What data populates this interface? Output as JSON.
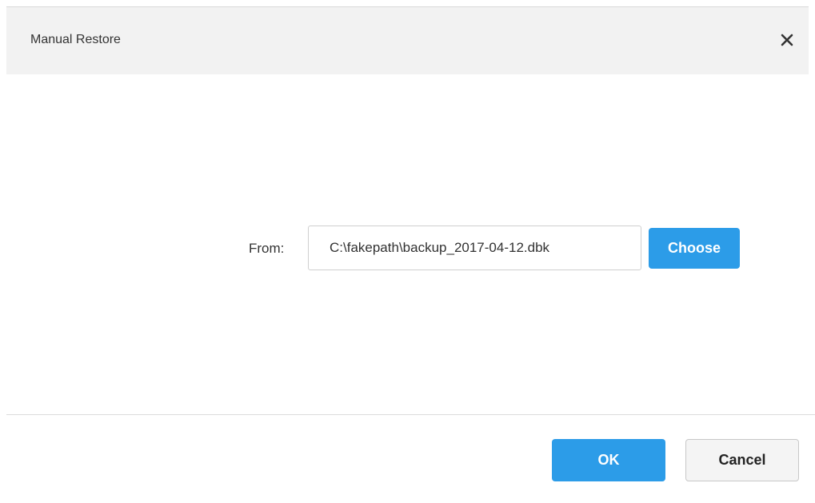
{
  "dialog": {
    "title": "Manual Restore",
    "close_icon": "close-icon"
  },
  "form": {
    "from_label": "From:",
    "file_path": "C:\\fakepath\\backup_2017-04-12.dbk",
    "choose_label": "Choose"
  },
  "footer": {
    "ok_label": "OK",
    "cancel_label": "Cancel"
  },
  "colors": {
    "primary": "#2c9ce8",
    "header_bg": "#f2f2f2",
    "secondary_bg": "#f4f4f4"
  }
}
